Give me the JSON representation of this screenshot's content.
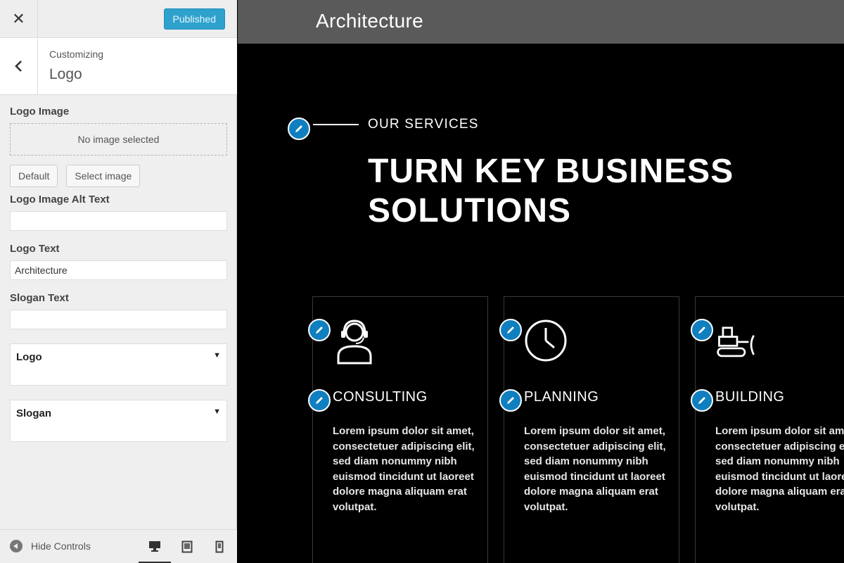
{
  "sidebar": {
    "close_label": "✕",
    "publish_label": "Published",
    "section_crumb": "Customizing",
    "section_title": "Logo",
    "logo_image": {
      "label": "Logo Image",
      "placeholder": "No image selected",
      "default_label": "Default",
      "select_label": "Select image"
    },
    "alt_text": {
      "label": "Logo Image Alt Text",
      "value": ""
    },
    "logo_text": {
      "label": "Logo Text",
      "value": "Architecture"
    },
    "slogan_text": {
      "label": "Slogan Text",
      "value": ""
    },
    "panels": [
      {
        "label": "Logo"
      },
      {
        "label": "Slogan"
      }
    ],
    "footer": {
      "hide_label": "Hide Controls"
    }
  },
  "preview": {
    "site_title": "Architecture",
    "eyebrow": "OUR SERVICES",
    "headline_line1": "TURN KEY BUSINESS",
    "headline_line2": "SOLUTIONS",
    "cards": [
      {
        "title": "CONSULTING",
        "icon": "support-agent-icon",
        "body": "Lorem ipsum dolor sit amet, consectetuer adipiscing elit, sed diam nonummy nibh euismod tincidunt ut laoreet dolore magna aliquam erat volutpat."
      },
      {
        "title": "PLANNING",
        "icon": "clock-icon",
        "body": "Lorem ipsum dolor sit amet, consectetuer adipiscing elit, sed diam nonummy nibh euismod tincidunt ut laoreet dolore magna aliquam erat volutpat."
      },
      {
        "title": "BUILDING",
        "icon": "bulldozer-icon",
        "body": "Lorem ipsum dolor sit amet, consectetuer adipiscing elit, sed diam nonummy nibh euismod tincidunt ut laoreet dolore magna aliquam erat volutpat."
      }
    ]
  },
  "colors": {
    "accent": "#2ea2cc",
    "edit_pen": "#0f7fbf",
    "preview_bg": "#000000",
    "preview_header": "#5a5a5a"
  }
}
